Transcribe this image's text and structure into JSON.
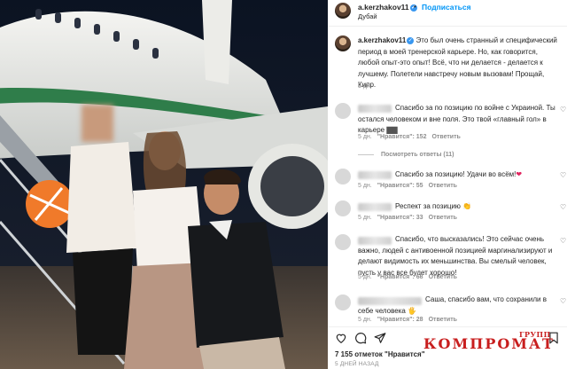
{
  "header": {
    "username": "a.kerzhakov11",
    "follow_label": "Подписаться",
    "separator": "•",
    "location": "Дубай"
  },
  "caption": {
    "username": "a.kerzhakov11",
    "text": "Это был очень странный и специфический период в моей тренерской карьере. Но, как говорится, любой опыт-это опыт! Всё, что ни делается - делается к лучшему. Полетели навстречу новым вызовам! Прощай, Кипр.",
    "time": "5 дн."
  },
  "comments": [
    {
      "text": "Спасибо за по позицию по войне с Украиной. Ты остался человеком и вне поля. Это твой «главный гол» в карьере",
      "emoji": "▇▇",
      "ago": "5 дн.",
      "likes": "\"Нравится\": 152",
      "reply": "Ответить"
    },
    {
      "text": "Спасибо за позицию! Удачи во всём!",
      "emoji": "❤",
      "ago": "5 дн.",
      "likes": "\"Нравится\": 55",
      "reply": "Ответить"
    },
    {
      "text": "Респект за позицию",
      "emoji": "👏",
      "ago": "5 дн.",
      "likes": "\"Нравится\": 33",
      "reply": "Ответить"
    },
    {
      "text": "Спасибо, что высказались! Это сейчас очень важно, людей с антивоенной позицией маргинализируют и делают видимость их меньшинства. Вы смелый человек, пусть у вас все будет хорошо!",
      "emoji": "",
      "ago": "5 дн.",
      "likes": "\"Нравится\": 68",
      "reply": "Ответить"
    },
    {
      "text": "Саша, спасибо вам, что сохранили в себе человека",
      "emoji": "🖐",
      "ago": "5 дн.",
      "likes": "\"Нравится\": 28",
      "reply": "Ответить"
    }
  ],
  "view_replies": "Посмотреть ответы (11)",
  "actions": {
    "likes_count": "7 155 отметок \"Нравится\"",
    "posted": "5 ДНЕЙ НАЗАД"
  },
  "watermark": {
    "text": "КОМПРОМАТ",
    "group": "ГРУПП"
  },
  "colors": {
    "accent": "#0095f6",
    "verified": "#3897f0",
    "watermark": "#c81e1e"
  },
  "icons": [
    "heart-icon",
    "comment-icon",
    "share-icon",
    "bookmark-icon",
    "verified-badge-icon"
  ]
}
